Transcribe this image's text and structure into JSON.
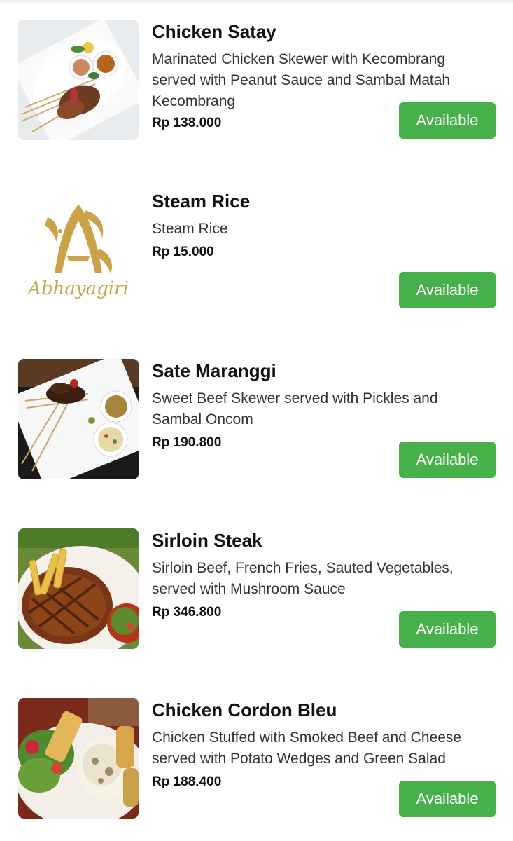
{
  "menu": {
    "items": [
      {
        "name": "Chicken Satay",
        "description": "Marinated Chicken Skewer with Kecombrang served with Peanut Sauce and Sambal Matah Kecombrang",
        "price": "Rp 138.000",
        "status": "Available",
        "image": "chicken-satay-photo"
      },
      {
        "name": "Steam Rice",
        "description": "Steam Rice",
        "price": "Rp 15.000",
        "status": "Available",
        "image": "abhayagiri-logo",
        "logo_text": "Abhayagiri"
      },
      {
        "name": "Sate Maranggi",
        "description": "Sweet Beef Skewer served with Pickles and Sambal Oncom",
        "price": "Rp 190.800",
        "status": "Available",
        "image": "sate-maranggi-photo"
      },
      {
        "name": "Sirloin Steak",
        "description": "Sirloin Beef, French Fries, Sauted Vegetables, served with Mushroom Sauce",
        "price": "Rp 346.800",
        "status": "Available",
        "image": "sirloin-steak-photo"
      },
      {
        "name": "Chicken Cordon Bleu",
        "description": "Chicken Stuffed with Smoked Beef and Cheese served with Potato Wedges and Green Salad",
        "price": "Rp 188.400",
        "status": "Available",
        "image": "chicken-cordon-bleu-photo"
      }
    ]
  },
  "colors": {
    "available_button": "#46b04a",
    "logo_gold": "#c9a24a"
  }
}
